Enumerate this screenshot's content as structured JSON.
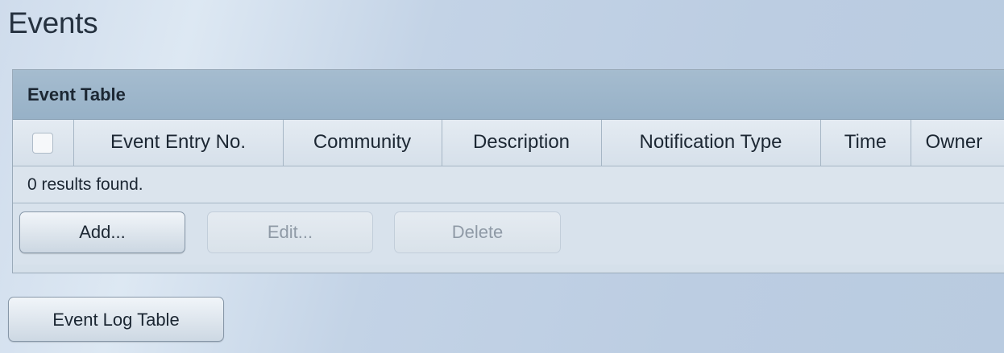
{
  "page": {
    "title": "Events"
  },
  "event_table": {
    "title": "Event Table",
    "columns": [
      "Event Entry No.",
      "Community",
      "Description",
      "Notification Type",
      "Time",
      "Owner"
    ],
    "select_all_checked": false,
    "results_text": "0 results found.",
    "buttons": {
      "add": "Add...",
      "edit": "Edit...",
      "delete": "Delete"
    }
  },
  "event_log_button": "Event Log Table",
  "colors": {
    "header_bar": "#a5bccf",
    "page_background": "#c3d3e6",
    "disabled_text": "#8f9aa6"
  }
}
